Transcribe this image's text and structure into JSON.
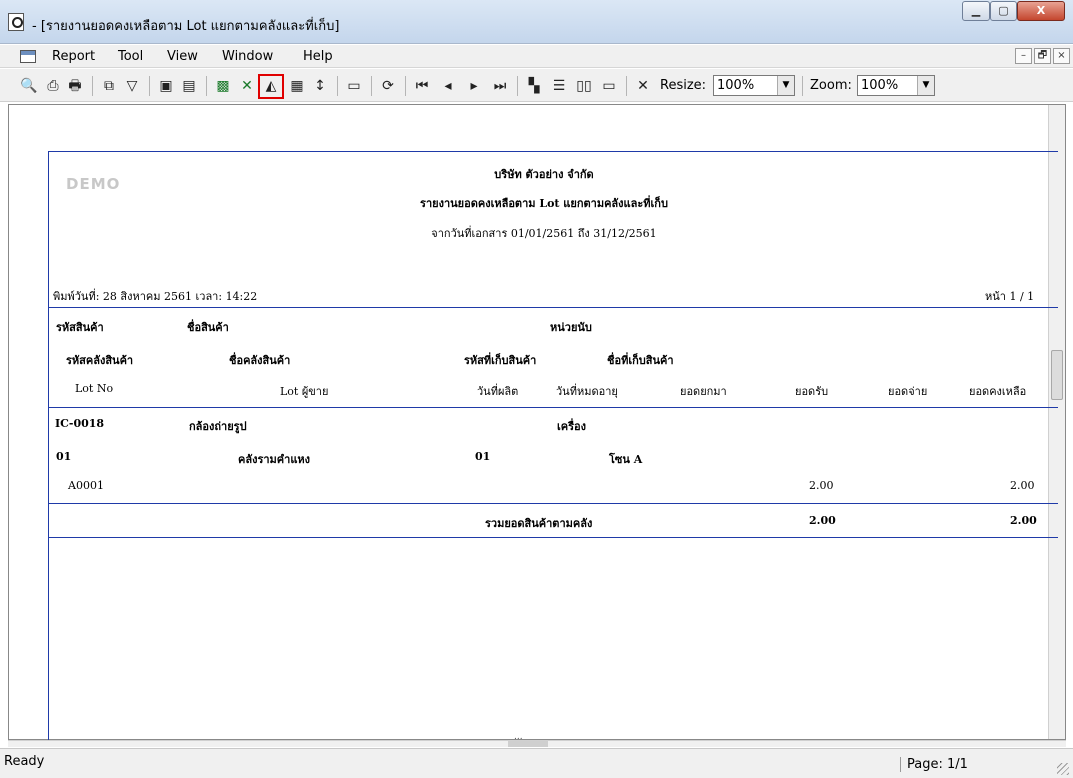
{
  "window": {
    "title": "- [รายงานยอดคงเหลือตาม Lot แยกตามคลังและที่เก็บ]",
    "controls": {
      "minimize": "▁",
      "maximize": "▢",
      "close": "X"
    }
  },
  "menu": {
    "items": [
      "Report",
      "Tool",
      "View",
      "Window",
      "Help"
    ],
    "mdi": {
      "minimize": "–",
      "restore": "🗗",
      "close": "×"
    }
  },
  "toolbar": {
    "icons": [
      "preview-icon",
      "print-setup-icon",
      "print-icon",
      "copy-icon",
      "filter-icon",
      "save-icon",
      "export-icon",
      "excel-icon",
      "excel-x-icon",
      "design-icon",
      "grid-icon",
      "fit-icon",
      "calculator-icon",
      "refresh-icon",
      "first-page-icon",
      "prev-page-icon",
      "next-page-icon",
      "last-page-icon",
      "multi-page-icon",
      "single-page-icon",
      "two-column-icon",
      "full-page-icon",
      "close-preview-icon"
    ],
    "resize_label": "Resize:",
    "resize_value": "100%",
    "zoom_label": "Zoom:",
    "zoom_value": "100%"
  },
  "report": {
    "watermark": "DEMO",
    "company": "บริษัท ตัวอย่าง จำกัด",
    "title": "รายงานยอดคงเหลือตาม Lot แยกตามคลังและที่เก็บ",
    "date_range": "จากวันที่เอกสาร 01/01/2561 ถึง 31/12/2561",
    "printed": "พิมพ์วันที่: 28 สิงหาคม 2561 เวลา: 14:22",
    "page": "หน้า 1 / 1",
    "headers": {
      "row1": [
        "รหัสสินค้า",
        "ชื่อสินค้า",
        "หน่วยนับ"
      ],
      "row2": [
        "รหัสคลังสินค้า",
        "ชื่อคลังสินค้า",
        "รหัสที่เก็บสินค้า",
        "ชื่อที่เก็บสินค้า"
      ],
      "row3": [
        "Lot No",
        "Lot ผู้ขาย",
        "วันที่ผลิต",
        "วันที่หมดอายุ",
        "ยอดยกมา",
        "ยอดรับ",
        "ยอดจ่าย",
        "ยอดคงเหลือ"
      ]
    },
    "product": {
      "code": "IC-0018",
      "name": "กล้องถ่ายรูป",
      "unit": "เครื่อง"
    },
    "warehouse": {
      "code": "01",
      "name": "คลังรามคำแหง",
      "location_code": "01",
      "location_name": "โซน A"
    },
    "lot": {
      "lot_no": "A0001",
      "received": "2.00",
      "balance": "2.00"
    },
    "total": {
      "label": "รวมยอดสินค้าตามคลัง",
      "received": "2.00",
      "balance": "2.00"
    }
  },
  "status": {
    "text": "Ready",
    "page": "Page: 1/1"
  },
  "scroll": {
    "h_marker": "..."
  }
}
